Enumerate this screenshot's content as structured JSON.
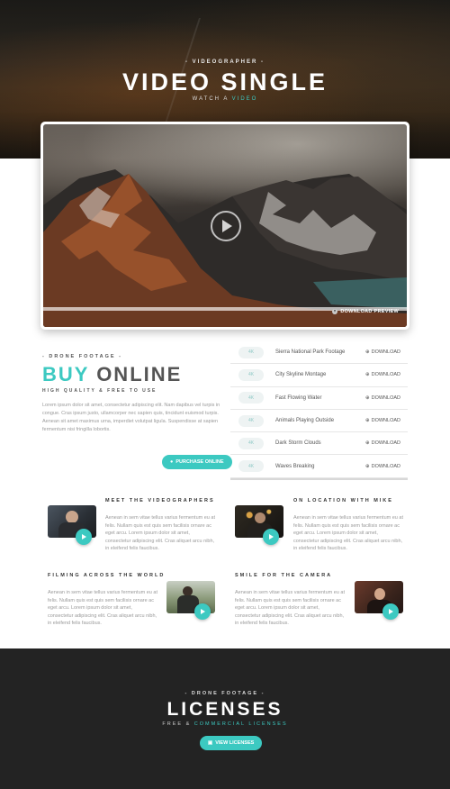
{
  "hero": {
    "eyebrow": "- VIDEOGRAPHER -",
    "title": "VIDEO SINGLE",
    "subtitle_a": "WATCH A",
    "subtitle_b": "VIDEO"
  },
  "video": {
    "preview_label": "DOWNLOAD PREVIEW",
    "progress": 1.0
  },
  "buy": {
    "eyebrow": "- DRONE FOOTAGE -",
    "title_a": "BUY",
    "title_b": "ONLINE",
    "subtitle": "HIGH QUALITY & FREE TO USE",
    "body": "Lorem ipsum dolor sit amet, consectetur adipiscing elit. Nam dapibus vel turpis in congue. Cras ipsum justo, ullamcorper nec sapien quis, tincidunt euismod turpis. Aenean sit amet maximus urna, imperdiet volutpat ligula. Suspendisse at sapien fermentum nisi fringilla lobortis.",
    "purchase_label": "PURCHASE ONLINE"
  },
  "tracks": [
    {
      "chip": "4K",
      "title": "Sierra National Park Footage",
      "download": "DOWNLOAD"
    },
    {
      "chip": "4K",
      "title": "City Skyline Montage",
      "download": "DOWNLOAD"
    },
    {
      "chip": "4K",
      "title": "Fast Flowing Water",
      "download": "DOWNLOAD"
    },
    {
      "chip": "4K",
      "title": "Animals Playing Outside",
      "download": "DOWNLOAD"
    },
    {
      "chip": "4K",
      "title": "Dark Storm Clouds",
      "download": "DOWNLOAD"
    },
    {
      "chip": "4K",
      "title": "Waves Breaking",
      "download": "DOWNLOAD"
    }
  ],
  "features": [
    {
      "heading": "MEET THE VIDEOGRAPHERS",
      "body": "Aenean in sem vitae tellus varius fermentum eu at felis. Nullam quis est quis sem facilisis ornare ac eget arcu. Lorem ipsum dolor sit amet, consectetur adipiscing elit. Cras aliquet arcu nibh, in eleifend felis faucibus."
    },
    {
      "heading": "ON LOCATION WITH MIKE",
      "body": "Aenean in sem vitae tellus varius fermentum eu at felis. Nullam quis est quis sem facilisis ornare ac eget arcu. Lorem ipsum dolor sit amet, consectetur adipiscing elit. Cras aliquet arcu nibh, in eleifend felis faucibus."
    },
    {
      "heading": "FILMING ACROSS THE WORLD",
      "body": "Aenean in sem vitae tellus varius fermentum eu at felis. Nullam quis est quis sem facilisis ornare ac eget arcu. Lorem ipsum dolor sit amet, consectetur adipiscing elit. Cras aliquet arcu nibh, in eleifend felis faucibus."
    },
    {
      "heading": "SMILE FOR THE CAMERA",
      "body": "Aenean in sem vitae tellus varius fermentum eu at felis. Nullam quis est quis sem facilisis ornare ac eget arcu. Lorem ipsum dolor sit amet, consectetur adipiscing elit. Cras aliquet arcu nibh, in eleifend felis faucibus."
    }
  ],
  "footer": {
    "eyebrow": "- DRONE FOOTAGE -",
    "title": "LICENSES",
    "subtitle_a": "FREE &",
    "subtitle_b": "COMMERCIAL LICENSES",
    "button_label": "VIEW LICENSES"
  },
  "colors": {
    "accent": "#3cc9c1",
    "dark": "#232323"
  }
}
